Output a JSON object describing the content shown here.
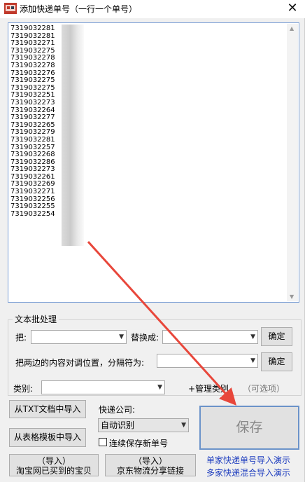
{
  "window": {
    "title": "添加快递单号（一行一个单号）",
    "close_glyph": "✕"
  },
  "textarea": {
    "lines": [
      "7319032281",
      "7319032281",
      "7319032271",
      "7319032275",
      "7319032278",
      "7319032278",
      "7319032276",
      "7319032275",
      "7319032275",
      "7319032251",
      "7319032273",
      "7319032264",
      "7319032277",
      "7319032265",
      "7319032279",
      "7319032281",
      "7319032257",
      "7319032268",
      "7319032286",
      "7319032273",
      "7319032261",
      "7319032269",
      "7319032271",
      "7319032256",
      "7319032255",
      "7319032254"
    ]
  },
  "batch": {
    "group_title": "文本批处理",
    "replace_from_label": "把:",
    "replace_to_label": "替换成:",
    "confirm_label": "确定",
    "adjust_label": "把两边的内容对调位置，分隔符为:",
    "confirm2_label": "确定"
  },
  "category": {
    "label": "类别:",
    "manage_label": "+管理类别",
    "optional_hint": "（可选项）"
  },
  "import": {
    "from_txt": "从TXT文档中导入",
    "from_template": "从表格模板中导入",
    "taobao_line1": "（导入）",
    "taobao_line2": "淘宝网已买到的宝贝",
    "jd_line1": "（导入）",
    "jd_line2": "京东物流分享链接"
  },
  "courier": {
    "label": "快递公司:",
    "selected": "自动识别",
    "keep_saving_label": "连续保存新单号",
    "keep_saving_checked": false
  },
  "save": {
    "label": "保存"
  },
  "links": {
    "single_demo": "单家快递单号导入演示",
    "multi_demo": "多家快递混合导入演示"
  },
  "colors": {
    "link": "#1f3ebf",
    "arrow": "#e8473b",
    "save_border": "#6b93c9"
  }
}
